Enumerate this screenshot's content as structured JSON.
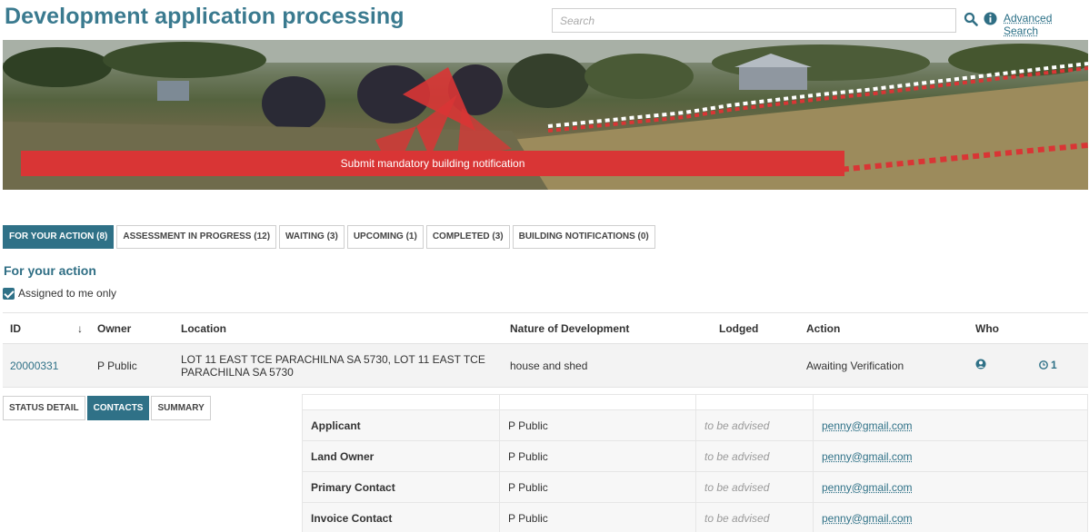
{
  "header": {
    "title": "Development application processing",
    "search_placeholder": "Search",
    "advanced_search": "Advanced Search"
  },
  "banner": {
    "button_label": "Submit mandatory building notification"
  },
  "tabs": [
    {
      "label": "FOR YOUR ACTION (8)",
      "active": true
    },
    {
      "label": "ASSESSMENT IN PROGRESS (12)"
    },
    {
      "label": "WAITING (3)"
    },
    {
      "label": "UPCOMING (1)"
    },
    {
      "label": "COMPLETED (3)"
    },
    {
      "label": "BUILDING NOTIFICATIONS (0)"
    }
  ],
  "section": {
    "title": "For your action",
    "checkbox_label": "Assigned to me only"
  },
  "table": {
    "headers": [
      "ID",
      "Owner",
      "Location",
      "Nature of Development",
      "Lodged",
      "Action",
      "Who",
      ""
    ],
    "sort_arrow": "↓",
    "row": {
      "id": "20000331",
      "owner": "P Public",
      "location": "LOT 11 EAST TCE PARACHILNA SA 5730, LOT 11 EAST TCE PARACHILNA SA 5730",
      "nature": "house and shed",
      "lodged": "",
      "action": "Awaiting Verification",
      "count": "1"
    }
  },
  "subtabs": [
    {
      "label": "STATUS DETAIL"
    },
    {
      "label": "CONTACTS",
      "active": true
    },
    {
      "label": "SUMMARY"
    }
  ],
  "contacts": [
    {
      "role": "Applicant",
      "name": "P Public",
      "phone": "to be advised",
      "email": "penny@gmail.com"
    },
    {
      "role": "Land Owner",
      "name": "P Public",
      "phone": "to be advised",
      "email": "penny@gmail.com"
    },
    {
      "role": "Primary Contact",
      "name": "P Public",
      "phone": "to be advised",
      "email": "penny@gmail.com"
    },
    {
      "role": "Invoice Contact",
      "name": "P Public",
      "phone": "to be advised",
      "email": "penny@gmail.com"
    }
  ],
  "colors": {
    "accent": "#2f7187",
    "banner_red": "#d93535"
  }
}
